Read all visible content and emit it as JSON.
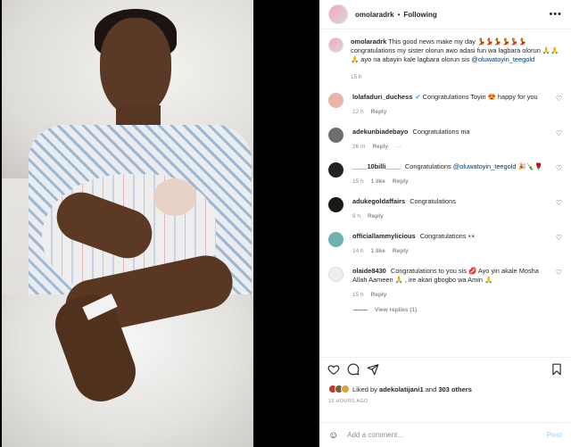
{
  "post": {
    "author": "omolaradrk",
    "separator": "•",
    "follow_status": "Following"
  },
  "caption": {
    "user": "omolaradrk",
    "text": "This good news make my day 💃💃💃💃💃💃 congratulations my sister olorun awo adasi fun wa lagbara olorun 🙏🙏🙏 ayo na abayin kale lagbara olorun sis ",
    "mention": "@oluwatoyin_teegold",
    "time": "15 h"
  },
  "comments": [
    {
      "user": "lolafaduri_duchess",
      "verified": "✔",
      "text": "Congratulations Toyin 😍 happy for you",
      "time": "12 h",
      "likes": "",
      "reply": "Reply"
    },
    {
      "user": "adekunbiadebayo",
      "text": "Congratulations ma",
      "time": "26 m",
      "likes": "",
      "reply": "Reply",
      "more": "···"
    },
    {
      "user": "____10billi____",
      "text": "Congratulations ",
      "mention": "@oluwatoyin_teegold",
      "text2": " 🎉🍾🌹",
      "time": "15 h",
      "likes": "1 like",
      "reply": "Reply"
    },
    {
      "user": "adukegoldaffairs",
      "text": "Congratulations",
      "time": "9 h",
      "likes": "",
      "reply": "Reply"
    },
    {
      "user": "officiallammylicious",
      "text": "Congratulations 👀",
      "time": "14 h",
      "likes": "1 like",
      "reply": "Reply"
    },
    {
      "user": "olaide8430",
      "text": "Congratulations to you sis 💋 Ayo yin akale Mosha Allah Aameen 🙏 , ire akari gbogbo wa Amin 🙏",
      "time": "15 h",
      "likes": "",
      "reply": "Reply"
    }
  ],
  "view_replies": "View replies (1)",
  "likes": {
    "prefix": "Liked by",
    "user": "adekolatijani1",
    "conj": "and",
    "count": "303 others"
  },
  "posted_time": "15 HOURS AGO",
  "add_comment": {
    "placeholder": "Add a comment…",
    "post_label": "Post"
  },
  "icons": [
    "heart-icon",
    "comment-icon",
    "share-icon",
    "bookmark-icon",
    "emoji-icon",
    "more-icon"
  ]
}
